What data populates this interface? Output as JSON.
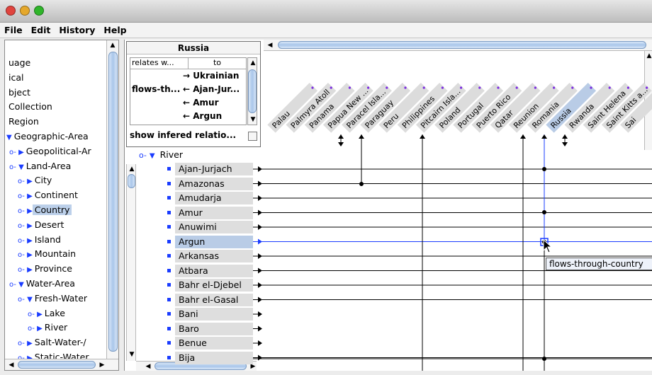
{
  "window": {
    "traffic_lights": {
      "close": "#e0443e",
      "minimize": "#e5a82c",
      "zoom": "#2fb52a"
    }
  },
  "menu": [
    "File",
    "Edit",
    "History",
    "Help"
  ],
  "left_tree": [
    {
      "label": "uage",
      "indent": 0,
      "twisty": ""
    },
    {
      "label": "ical",
      "indent": 0,
      "twisty": ""
    },
    {
      "label": "bject",
      "indent": 0,
      "twisty": ""
    },
    {
      "label": "Collection",
      "indent": 0,
      "twisty": ""
    },
    {
      "label": "Region",
      "indent": 0,
      "twisty": ""
    },
    {
      "label": "Geographic-Area",
      "indent": 1,
      "twisty": "expanded"
    },
    {
      "label": "Geopolitical-Ar",
      "indent": 2,
      "twisty": "collapsed"
    },
    {
      "label": "Land-Area",
      "indent": 2,
      "twisty": "expanded"
    },
    {
      "label": "City",
      "indent": 3,
      "twisty": "collapsed"
    },
    {
      "label": "Continent",
      "indent": 3,
      "twisty": "collapsed"
    },
    {
      "label": "Country",
      "indent": 3,
      "twisty": "collapsed",
      "selected": true
    },
    {
      "label": "Desert",
      "indent": 3,
      "twisty": "collapsed"
    },
    {
      "label": "Island",
      "indent": 3,
      "twisty": "collapsed"
    },
    {
      "label": "Mountain",
      "indent": 3,
      "twisty": "collapsed"
    },
    {
      "label": "Province",
      "indent": 3,
      "twisty": "collapsed"
    },
    {
      "label": "Water-Area",
      "indent": 2,
      "twisty": "expanded"
    },
    {
      "label": "Fresh-Water",
      "indent": 3,
      "twisty": "expanded"
    },
    {
      "label": "Lake",
      "indent": 4,
      "twisty": "collapsed"
    },
    {
      "label": "River",
      "indent": 4,
      "twisty": "collapsed"
    },
    {
      "label": "Salt-Water-/",
      "indent": 3,
      "twisty": "collapsed"
    },
    {
      "label": "Static-Water",
      "indent": 3,
      "twisty": "collapsed"
    }
  ],
  "popup": {
    "title": "Russia",
    "col_relates": "relates w...",
    "col_to": "to",
    "rows": [
      {
        "rel": "",
        "arrow": "→",
        "target": "Ukrainian"
      },
      {
        "rel": "flows-th...",
        "arrow": "←",
        "target": "Ajan-Jur..."
      },
      {
        "rel": "",
        "arrow": "←",
        "target": "Amur"
      },
      {
        "rel": "",
        "arrow": "←",
        "target": "Argun"
      }
    ],
    "show_inferred": "show infered relatio...",
    "show_inferred_checked": false
  },
  "columns": [
    "Palau",
    "Palmyra Atoll",
    "Panama",
    "Papua New ...",
    "Paracel Isla...",
    "Paraguay",
    "Peru",
    "Philippines",
    "Pitcairn Isla...",
    "Poland",
    "Portugal",
    "Puerto Rico",
    "Qatar",
    "Reunion",
    "Romania",
    "Russia",
    "Rwanda",
    "Saint Helena",
    "Saint Kitts a...",
    "Sai"
  ],
  "selected_column": "Russia",
  "river_node": "River",
  "rows": [
    {
      "label": "Ajan-Jurjach"
    },
    {
      "label": "Amazonas"
    },
    {
      "label": "Amudarja"
    },
    {
      "label": "Amur"
    },
    {
      "label": "Anuwimi"
    },
    {
      "label": "Argun",
      "selected": true
    },
    {
      "label": "Arkansas"
    },
    {
      "label": "Atbara"
    },
    {
      "label": "Bahr el-Djebel"
    },
    {
      "label": "Bahr el-Gasal"
    },
    {
      "label": "Bani"
    },
    {
      "label": "Baro"
    },
    {
      "label": "Benue"
    },
    {
      "label": "Bija"
    }
  ],
  "tooltip": "flows-through-country",
  "colors": {
    "accent": "#1a3cff",
    "selection": "#bcd0ea",
    "line": "#000000"
  }
}
